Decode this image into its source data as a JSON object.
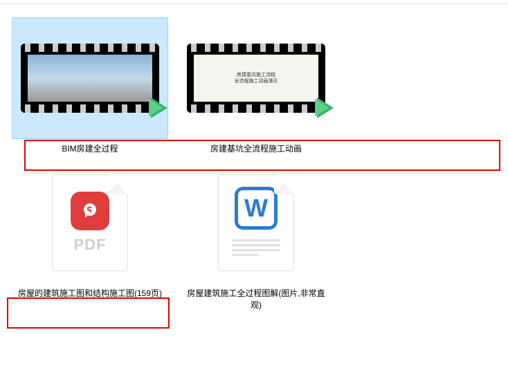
{
  "files": [
    {
      "label": "BIM房建全过程",
      "type": "video"
    },
    {
      "label": "房建基坑全流程施工动画",
      "type": "video"
    },
    {
      "label": "房屋的建筑施工图和结构施工图(159页)",
      "type": "pdf"
    },
    {
      "label": "房屋建筑施工全过程图解(图片,非常直观)",
      "type": "word"
    }
  ],
  "pdf_label": "PDF",
  "word_letter": "W"
}
